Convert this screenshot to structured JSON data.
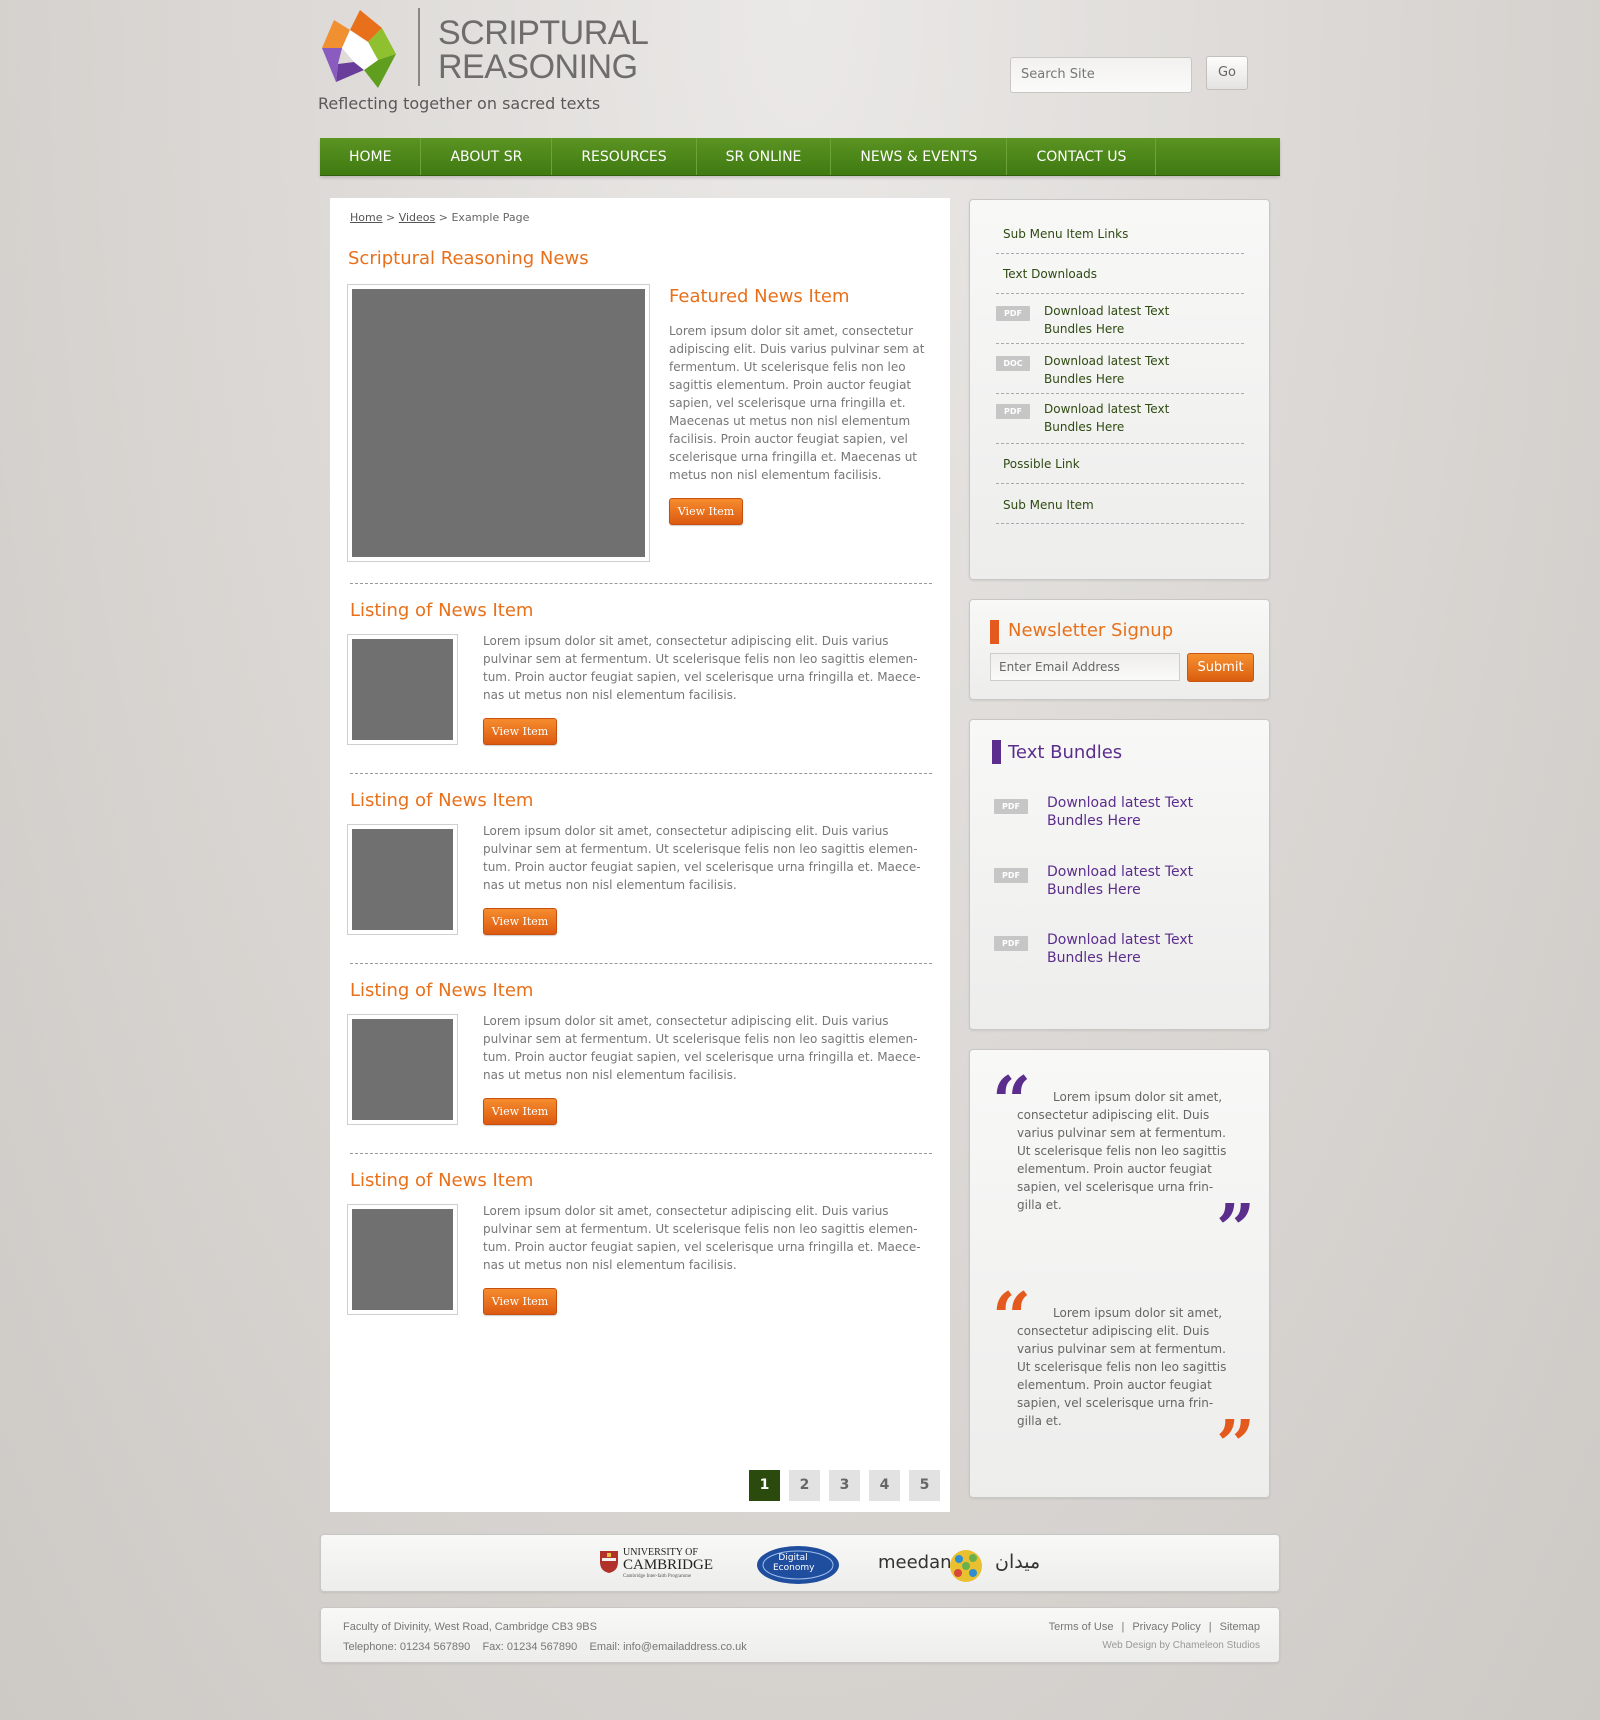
{
  "header": {
    "logo_line1": "SCRIPTURAL",
    "logo_line2": "REASONING",
    "tagline": "Reflecting together on sacred texts",
    "search_placeholder": "Search Site",
    "search_button": "Go"
  },
  "nav": {
    "items": [
      "HOME",
      "ABOUT SR",
      "RESOURCES",
      "SR ONLINE",
      "NEWS & EVENTS",
      "CONTACT US"
    ]
  },
  "breadcrumb": {
    "home": "Home",
    "sep1": " > ",
    "videos": "Videos",
    "sep2": " > ",
    "current": "Example Page"
  },
  "main": {
    "section_title": "Scriptural Reasoning News",
    "featured": {
      "title": "Featured News Item",
      "text": "Lorem ipsum dolor sit amet, consectetur adipiscing elit. Duis varius pulvinar sem at fermentum. Ut scelerisque felis non leo sagittis elementum. Proin auctor feugiat sapien, vel scelerisque urna fringilla et. Maecenas ut metus non nisl elementum facilisis. Proin auctor feugiat sapien, vel scelerisque urna fringilla et. Maecenas ut metus non nisl elementum facilisis.",
      "button": "View Item"
    },
    "listings": [
      {
        "title": "Listing of News Item",
        "text": "Lorem ipsum dolor sit amet, consectetur adipiscing elit. Duis varius pulvinar sem at fermentum. Ut scelerisque felis non leo sagittis elemen-tum. Proin auctor feugiat sapien, vel scelerisque urna fringilla et. Maece-nas ut metus non nisl elementum facilisis.",
        "button": "View Item"
      },
      {
        "title": "Listing of News Item",
        "text": "Lorem ipsum dolor sit amet, consectetur adipiscing elit. Duis varius pulvinar sem at fermentum. Ut scelerisque felis non leo sagittis elemen-tum. Proin auctor feugiat sapien, vel scelerisque urna fringilla et. Maece-nas ut metus non nisl elementum facilisis.",
        "button": "View Item"
      },
      {
        "title": "Listing of News Item",
        "text": "Lorem ipsum dolor sit amet, consectetur adipiscing elit. Duis varius pulvinar sem at fermentum. Ut scelerisque felis non leo sagittis elemen-tum. Proin auctor feugiat sapien, vel scelerisque urna fringilla et. Maece-nas ut metus non nisl elementum facilisis.",
        "button": "View Item"
      },
      {
        "title": "Listing of News Item",
        "text": "Lorem ipsum dolor sit amet, consectetur adipiscing elit. Duis varius pulvinar sem at fermentum. Ut scelerisque felis non leo sagittis elemen-tum. Proin auctor feugiat sapien, vel scelerisque urna fringilla et. Maece-nas ut metus non nisl elementum facilisis.",
        "button": "View Item"
      }
    ],
    "pager": [
      "1",
      "2",
      "3",
      "4",
      "5"
    ],
    "pager_active": "1"
  },
  "submenu": {
    "items": [
      {
        "label": "Sub Menu Item Links"
      },
      {
        "label": "Text Downloads"
      },
      {
        "badge": "PDF",
        "label": "Download latest Text Bundles Here"
      },
      {
        "badge": "DOC",
        "label": "Download latest Text Bundles Here"
      },
      {
        "badge": "PDF",
        "label": "Download latest Text Bundles Here"
      },
      {
        "label": "Possible Link"
      },
      {
        "label": "Sub Menu Item"
      }
    ]
  },
  "newsletter": {
    "title": "Newsletter Signup",
    "placeholder": "Enter Email Address",
    "button": "Submit"
  },
  "text_bundles": {
    "title": "Text Bundles",
    "items": [
      {
        "badge": "PDF",
        "label": "Download latest Text Bundles Here"
      },
      {
        "badge": "PDF",
        "label": "Download latest Text Bundles Here"
      },
      {
        "badge": "PDF",
        "label": "Download latest Text Bundles Here"
      }
    ]
  },
  "quotes": [
    {
      "text": "Lorem ipsum dolor sit amet, consectetur adipiscing elit. Duis varius pulvinar sem at fermentum. Ut scelerisque felis non leo sagittis elementum. Proin auctor feugiat sapien, vel scelerisque urna frin-gilla et.",
      "color": "#5b2d8c"
    },
    {
      "text": "Lorem ipsum dolor sit amet, consectetur adipiscing elit. Duis varius pulvinar sem at fermentum. Ut scelerisque felis non leo sagittis elementum. Proin auctor feugiat sapien, vel scelerisque urna frin-gilla et.",
      "color": "#e45a1e"
    }
  ],
  "partners": {
    "cambridge_line1": "UNIVERSITY OF",
    "cambridge_line2": "CAMBRIDGE",
    "cambridge_sub": "Cambridge Inter-faith Programme",
    "digital_line1": "Digital",
    "digital_line2": "Economy",
    "meedan": "meedan",
    "meedan_arabic": "ميدان"
  },
  "footer": {
    "address": "Faculty of Divinity, West Road, Cambridge CB3 9BS",
    "contact": "Telephone: 01234 567890    Fax: 01234 567890    Email: info@emailaddress.co.uk",
    "links": [
      "Terms of Use",
      "Privacy Policy",
      "Sitemap"
    ],
    "credit": "Web Design by Chameleon Studios"
  },
  "colors": {
    "accent_orange": "#e8701a",
    "nav_green": "#4a8519",
    "purple": "#5b2d8c"
  }
}
